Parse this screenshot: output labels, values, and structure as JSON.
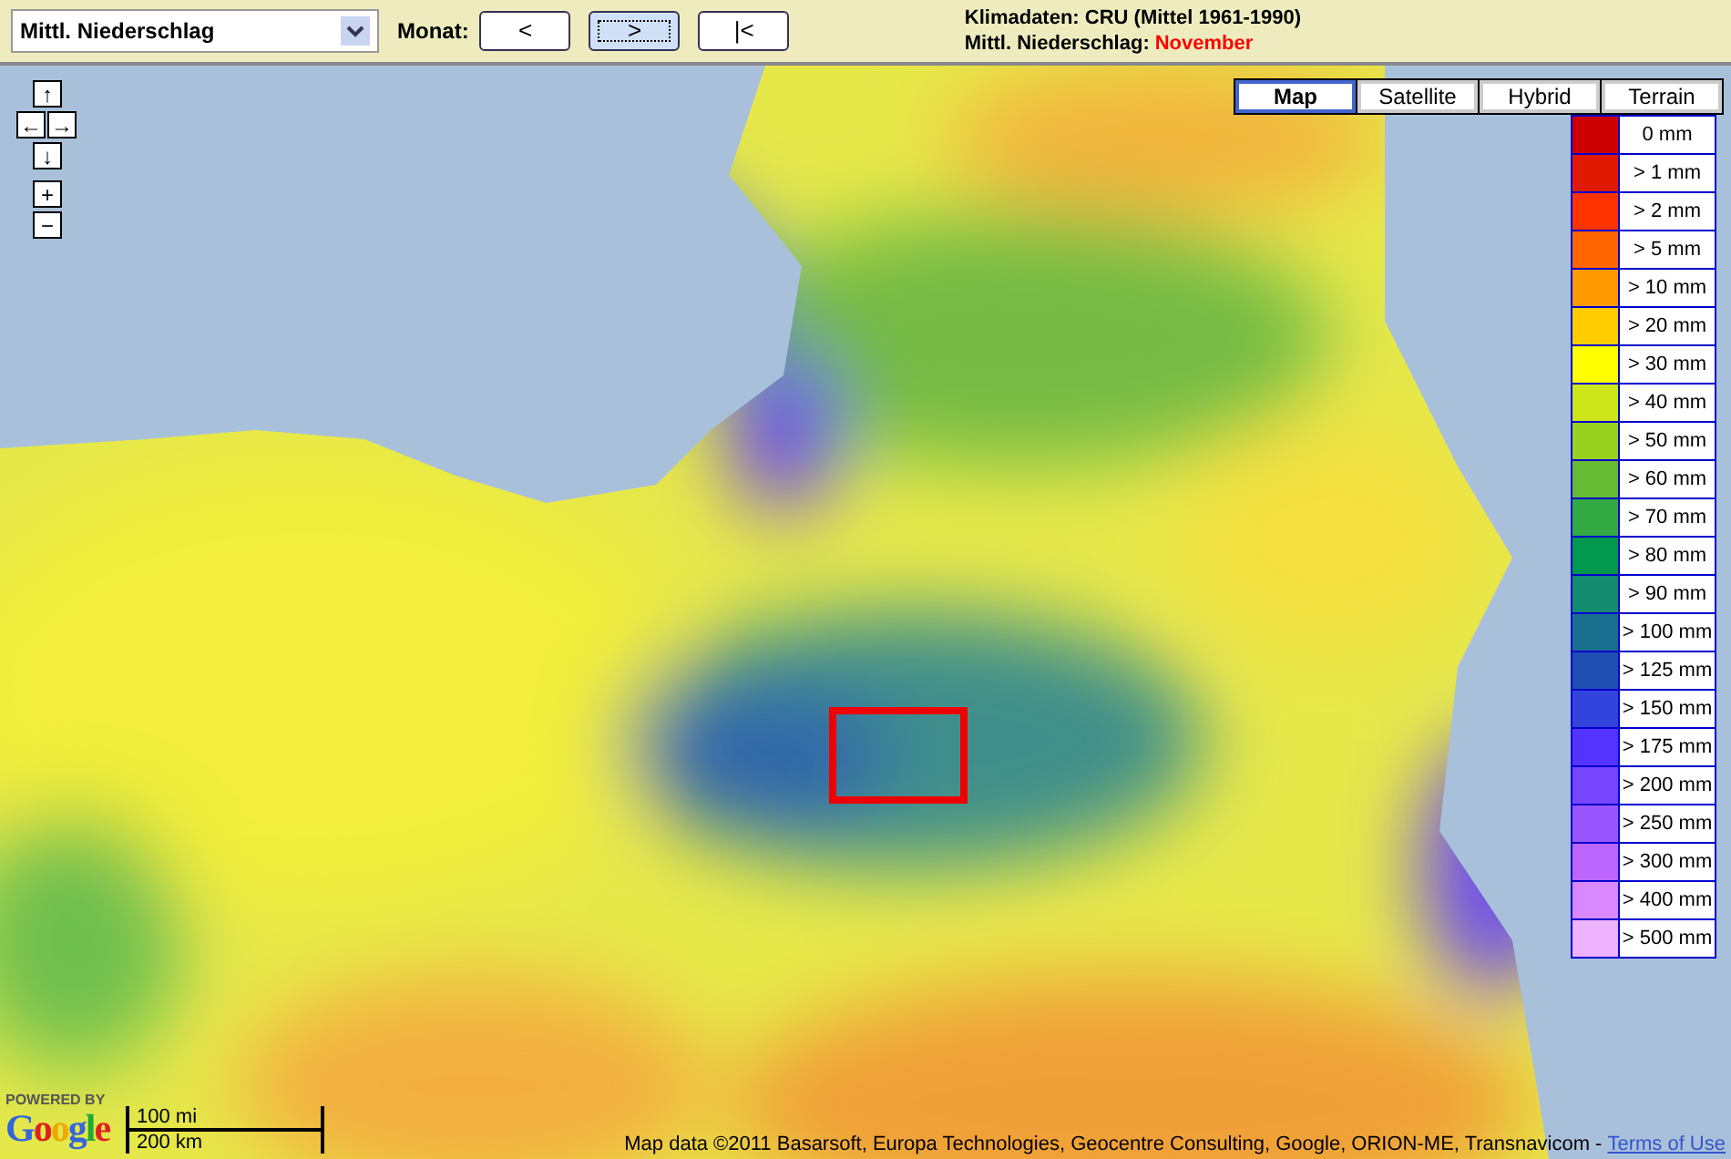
{
  "toolbar": {
    "dataset": {
      "value": "Mittl. Niederschlag"
    },
    "month_label": "Monat:",
    "buttons": [
      {
        "label": "<",
        "focused": false
      },
      {
        "label": ">",
        "focused": true
      },
      {
        "label": "|<",
        "focused": false
      }
    ],
    "info": {
      "line_1": "Klimadaten: CRU (Mittel 1961-1990)",
      "line_2_label": "Mittl. Niederschlag:",
      "month": "November"
    }
  },
  "map": {
    "pan_zoom": [
      "↑",
      "←",
      "→",
      "↓",
      "+",
      "−"
    ],
    "map_types": [
      {
        "label": "Map",
        "selected": true
      },
      {
        "label": "Satellite",
        "selected": false
      },
      {
        "label": "Hybrid",
        "selected": false
      },
      {
        "label": "Terrain",
        "selected": false
      }
    ],
    "legend": [
      {
        "label": "0 mm",
        "color": "#cc0000"
      },
      {
        "label": "> 1 mm",
        "color": "#e01a00"
      },
      {
        "label": "> 2 mm",
        "color": "#ff3300"
      },
      {
        "label": "> 5 mm",
        "color": "#ff6600"
      },
      {
        "label": "> 10 mm",
        "color": "#ff9900"
      },
      {
        "label": "> 20 mm",
        "color": "#ffcc00"
      },
      {
        "label": "> 30 mm",
        "color": "#ffff00"
      },
      {
        "label": "> 40 mm",
        "color": "#cce619"
      },
      {
        "label": "> 50 mm",
        "color": "#99d11f"
      },
      {
        "label": "> 60 mm",
        "color": "#66bb33"
      },
      {
        "label": "> 70 mm",
        "color": "#33aa44"
      },
      {
        "label": "> 80 mm",
        "color": "#00994d"
      },
      {
        "label": "> 90 mm",
        "color": "#148a6e"
      },
      {
        "label": "> 100 mm",
        "color": "#1a6e8f"
      },
      {
        "label": "> 125 mm",
        "color": "#1f4fb3"
      },
      {
        "label": "> 150 mm",
        "color": "#3344dd"
      },
      {
        "label": "> 175 mm",
        "color": "#5533ff"
      },
      {
        "label": "> 200 mm",
        "color": "#7744ff"
      },
      {
        "label": "> 250 mm",
        "color": "#9955ff"
      },
      {
        "label": "> 300 mm",
        "color": "#bb66ff"
      },
      {
        "label": "> 400 mm",
        "color": "#d988ff"
      },
      {
        "label": "> 500 mm",
        "color": "#eeb3ff"
      }
    ],
    "powered_by": "POWERED BY",
    "logo": "Google",
    "scale": [
      "100 mi",
      "200 km"
    ],
    "attribution": "Map data ©2011 Basarsoft, Europa Technologies, Geocentre Consulting, Google, ORION-ME, Transnavicom -",
    "terms_link": "Terms of Use"
  }
}
